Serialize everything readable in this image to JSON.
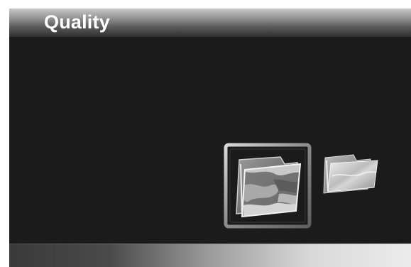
{
  "header": {
    "title": "Quality"
  },
  "thumbnails": [
    {
      "icon": "photo-folder-icon",
      "selected": true
    },
    {
      "icon": "folder-icon",
      "selected": false
    }
  ],
  "colors": {
    "background": "#1b1b1b",
    "header_top": "#c8c8c8",
    "header_bottom": "#2f2f2f",
    "selection_frame": "#9a9a9a"
  }
}
